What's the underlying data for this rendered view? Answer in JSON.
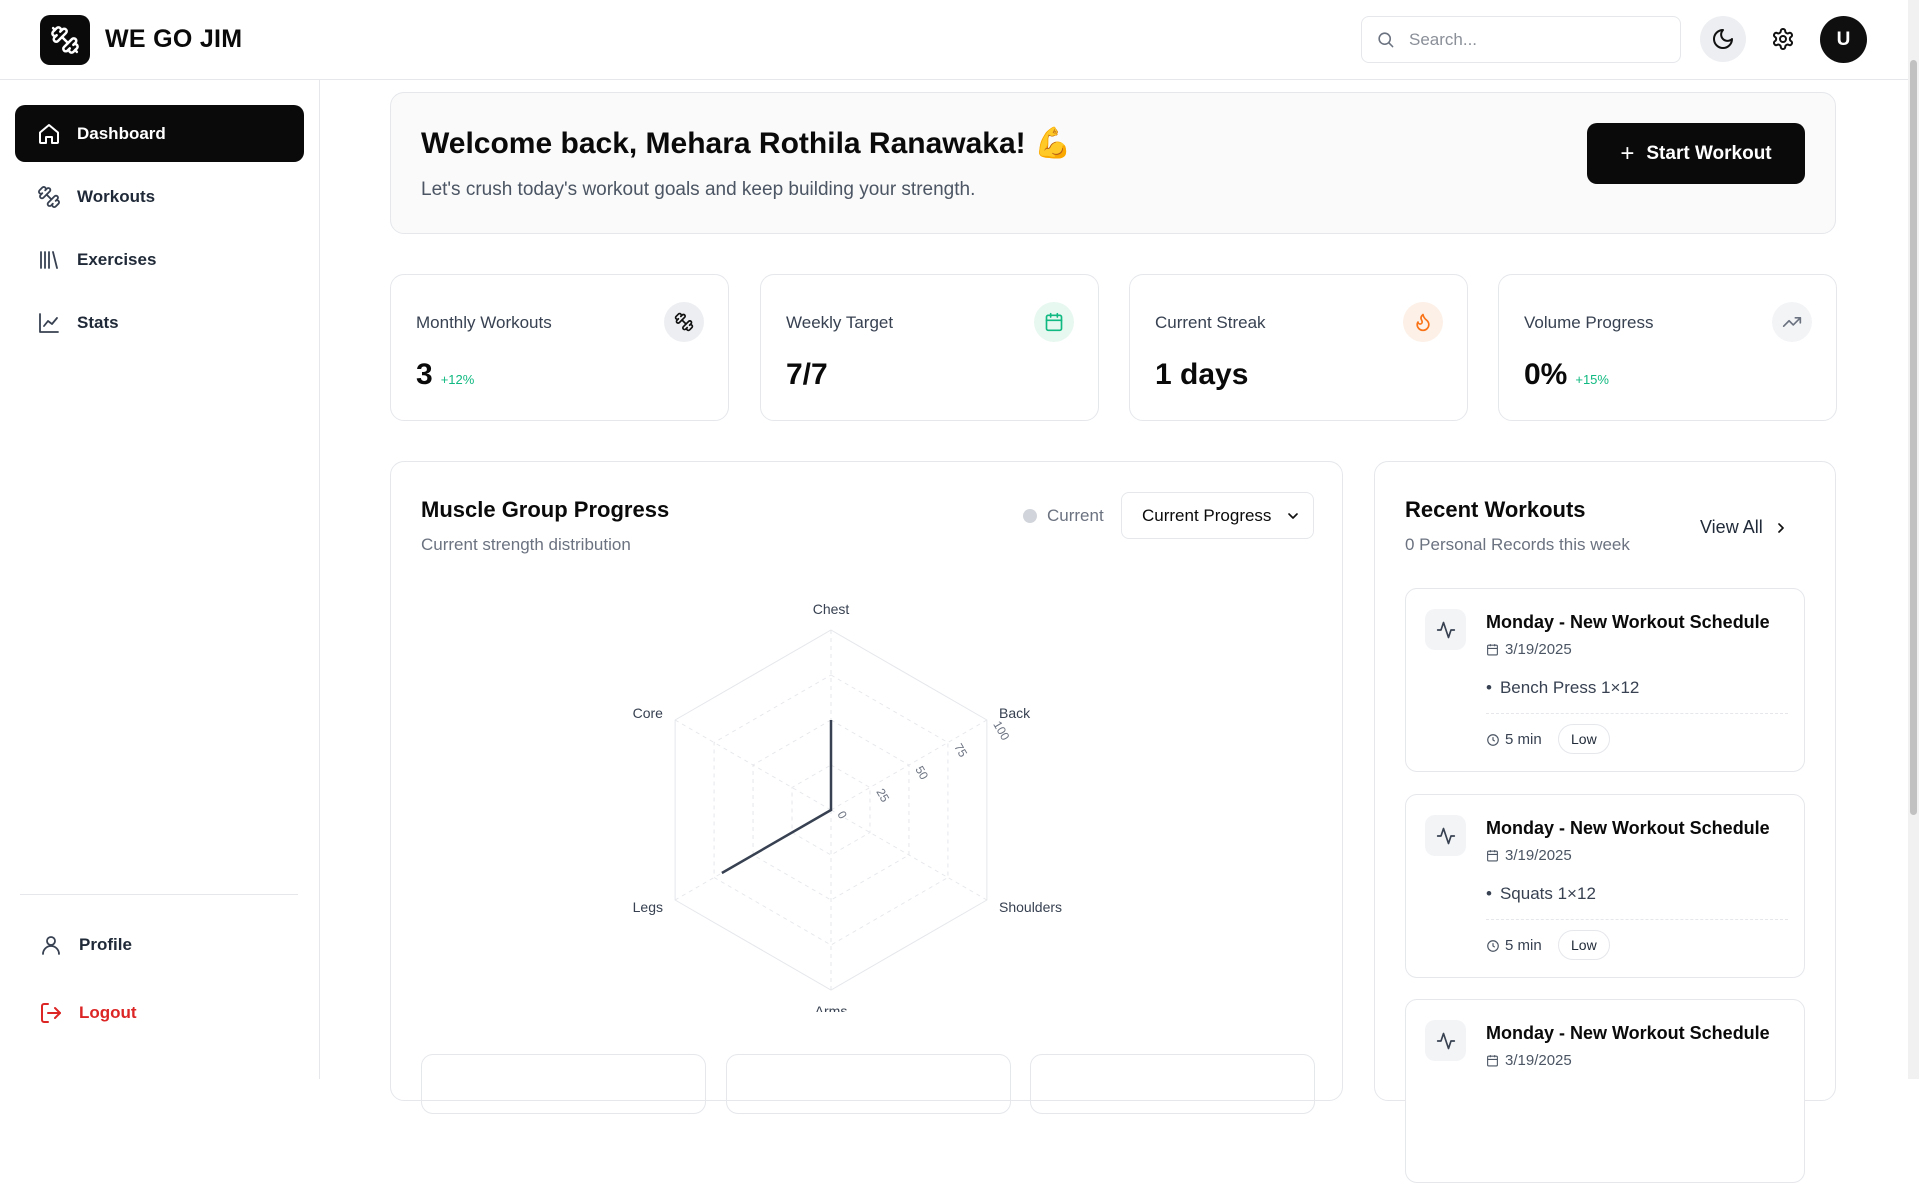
{
  "app": {
    "title": "WE GO JIM",
    "logo_icon": "dumbbell-icon"
  },
  "header": {
    "search_placeholder": "Search...",
    "theme_icon": "moon-icon",
    "settings_icon": "gear-icon",
    "avatar_initial": "U"
  },
  "sidebar": {
    "items": [
      {
        "label": "Dashboard",
        "icon": "home-icon",
        "active": true
      },
      {
        "label": "Workouts",
        "icon": "dumbbell-icon",
        "active": false
      },
      {
        "label": "Exercises",
        "icon": "library-icon",
        "active": false
      },
      {
        "label": "Stats",
        "icon": "line-chart-icon",
        "active": false
      }
    ],
    "profile_label": "Profile",
    "logout_label": "Logout"
  },
  "welcome": {
    "title": "Welcome back, Mehara Rothila Ranawaka! 💪",
    "subtitle": "Let's crush today's workout goals and keep building your strength.",
    "start_button": "Start Workout"
  },
  "stats": [
    {
      "label": "Monthly Workouts",
      "value": "3",
      "delta": "+12%",
      "icon": "dumbbell-icon",
      "icon_bg": "#eceef1",
      "icon_color": "#111111"
    },
    {
      "label": "Weekly Target",
      "value": "7/7",
      "delta": "",
      "icon": "calendar-icon",
      "icon_bg": "#e7f8f0",
      "icon_color": "#10b981"
    },
    {
      "label": "Current Streak",
      "value": "1 days",
      "delta": "",
      "icon": "flame-icon",
      "icon_bg": "#fdf0e7",
      "icon_color": "#f97316"
    },
    {
      "label": "Volume Progress",
      "value": "0%",
      "delta": "+15%",
      "icon": "trending-up-icon",
      "icon_bg": "#f3f4f6",
      "icon_color": "#6b7280"
    }
  ],
  "muscle_panel": {
    "title": "Muscle Group Progress",
    "subtitle": "Current strength distribution",
    "legend_label": "Current",
    "select_value": "Current Progress"
  },
  "chart_data": {
    "type": "radar",
    "categories": [
      "Chest",
      "Back",
      "Shoulders",
      "Arms",
      "Legs",
      "Core"
    ],
    "radial_ticks": [
      "0",
      "25",
      "50",
      "75",
      "100"
    ],
    "rlim": [
      0,
      100
    ],
    "series": [
      {
        "name": "Current",
        "values": [
          50,
          0,
          0,
          0,
          70,
          0
        ]
      }
    ],
    "grid": true,
    "legend": "top-right"
  },
  "recent": {
    "title": "Recent Workouts",
    "subtitle": "0 Personal Records this week",
    "view_all": "View All",
    "workouts": [
      {
        "title": "Monday - New Workout Schedule",
        "date": "3/19/2025",
        "exercise": "Bench Press 1×12",
        "duration": "5 min",
        "intensity": "Low"
      },
      {
        "title": "Monday - New Workout Schedule",
        "date": "3/19/2025",
        "exercise": "Squats 1×12",
        "duration": "5 min",
        "intensity": "Low"
      },
      {
        "title": "Monday - New Workout Schedule",
        "date": "3/19/2025",
        "exercise": "",
        "duration": "",
        "intensity": ""
      }
    ]
  },
  "colors": {
    "accent": "#0a0a0a",
    "success": "#10b981",
    "danger": "#dc2626"
  }
}
